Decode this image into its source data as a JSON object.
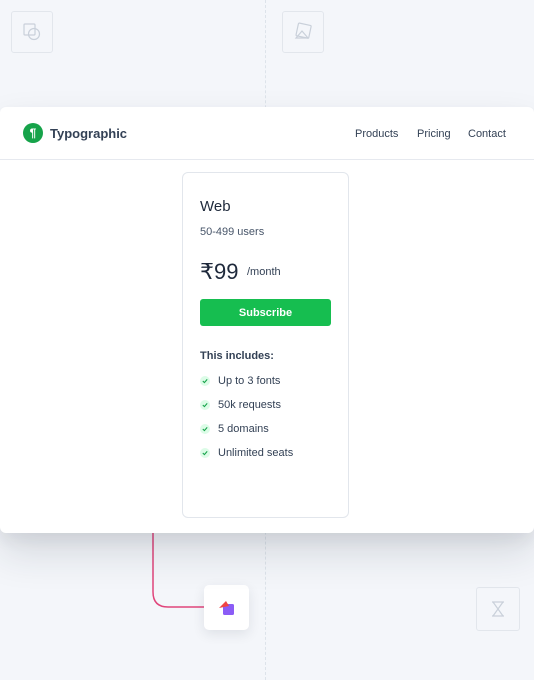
{
  "brand": {
    "name": "Typographic",
    "logo_glyph": "¶",
    "color": "#16a34a"
  },
  "nav": {
    "links": [
      "Products",
      "Pricing",
      "Contact"
    ]
  },
  "plan": {
    "name": "Web",
    "users": "50-499 users",
    "price": "₹99",
    "period": "/month",
    "cta": "Subscribe",
    "cta_color": "#16be50",
    "includes_title": "This includes:",
    "features": [
      "Up to 3 fonts",
      "50k requests",
      "5 domains",
      "Unlimited seats"
    ]
  },
  "background": {
    "icons": [
      "shapes-icon",
      "shapes-alt-icon",
      "hourglass-icon"
    ],
    "connector_color": "#e0457b",
    "app_icon_color": "#8b5cf6"
  }
}
